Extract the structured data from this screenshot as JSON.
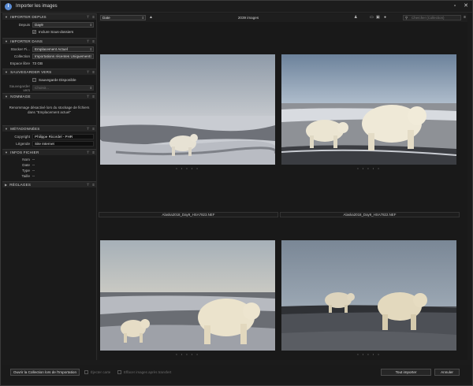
{
  "window": {
    "title": "Importer les images"
  },
  "sidebar": {
    "importer_depuis": {
      "title": "IMPORTER DEPUIS",
      "depuis_label": "Depuis",
      "depuis_value": "Day9",
      "subfolders_label": "Inclure Sous-dossiers"
    },
    "importer_dans": {
      "title": "IMPORTER DANS",
      "stocker_label": "Stocker Fi...",
      "stocker_value": "Emplacement Actuel",
      "collection_label": "Collection",
      "collection_value": "Importations récentes Uniquement",
      "espace_label": "Espace libre",
      "espace_value": "73 GB"
    },
    "sauvegarder": {
      "title": "SAUVEGARDER VERS",
      "backup_label": "Sauvegarde Disponible",
      "sauvegarder_label": "Sauvegarder vers",
      "choose_value": "Choisir..."
    },
    "nommage": {
      "title": "NOMMAGE",
      "note": "Renommage désactivé lors du stockage de fichiers dans \"Emplacement actuel\""
    },
    "metadonnees": {
      "title": "MÉTADONNÉES",
      "copyright_label": "Copyright",
      "copyright_value": "Philippe Ricordel - PHR",
      "legende_label": "Légende",
      "legende_value": "Site Internet"
    },
    "infos": {
      "title": "INFOS FICHIER",
      "nom_label": "Nom",
      "date_label": "Date",
      "type_label": "Type",
      "taille_label": "Taille",
      "empty": "--"
    },
    "reglages": {
      "title": "RÉGLAGES"
    }
  },
  "toolbar": {
    "sort_value": "Date",
    "count": "2039 images",
    "search_placeholder": "Chercher (Collection)"
  },
  "thumbnails": [
    {
      "filename": "Alaska2018_Day9_HSA7823.NEF"
    },
    {
      "filename": "Alaska2018_Day9_HSA7822.NEF"
    },
    {
      "filename": ""
    },
    {
      "filename": ""
    }
  ],
  "thumb_dots": "• • • • •",
  "footer": {
    "open_collection": "Ouvrir la Collection lors de l'Importation",
    "eject_card": "Éjecter carte",
    "delete_after": "Effacer images après transfert",
    "import_all": "Tout importer",
    "cancel": "Annuler"
  }
}
